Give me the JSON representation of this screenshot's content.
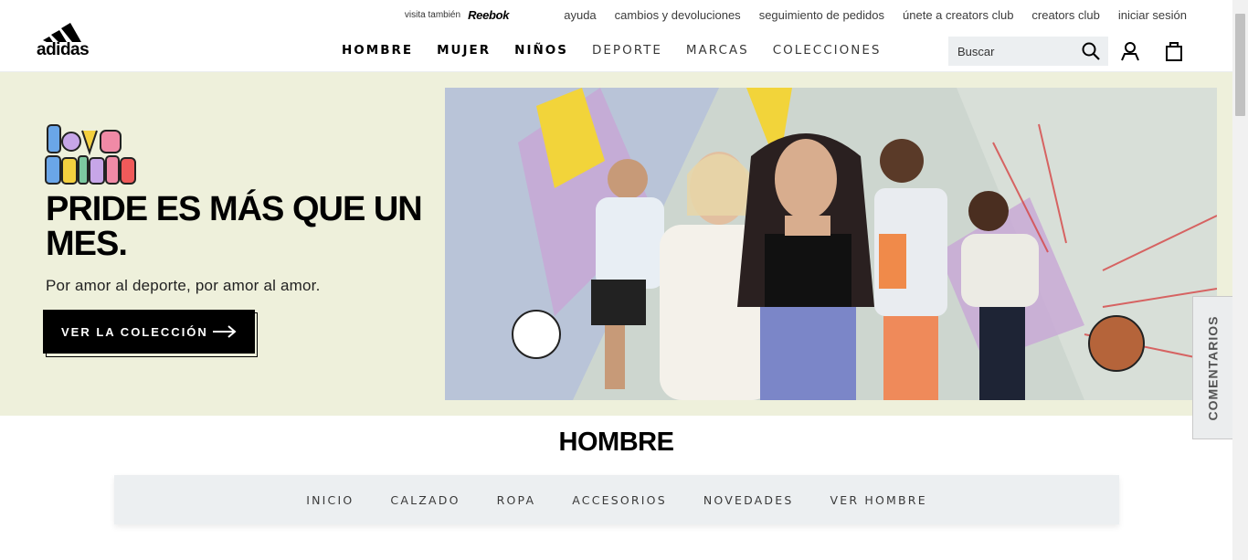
{
  "header": {
    "brand": "adidas",
    "util": {
      "also_visit": "visita también",
      "partner": "Reebok",
      "links": [
        "ayuda",
        "cambios y devoluciones",
        "seguimiento de pedidos",
        "únete a creators club",
        "creators club",
        "iniciar sesión"
      ]
    },
    "nav": [
      "HOMBRE",
      "MUJER",
      "NIÑOS",
      "DEPORTE",
      "MARCAS",
      "COLECCIONES"
    ],
    "search": {
      "placeholder": "Buscar"
    }
  },
  "hero": {
    "campaign_logo": "Love Unites",
    "title": "PRIDE ES MÁS QUE UN MES.",
    "subtitle": "Por amor al deporte, por amor al amor.",
    "cta": "VER LA COLECCIÓN"
  },
  "feedback": "COMENTARIOS",
  "section": {
    "title": "HOMBRE",
    "subnav": [
      "INICIO",
      "CALZADO",
      "ROPA",
      "ACCESORIOS",
      "NOVEDADES",
      "VER HOMBRE"
    ]
  },
  "colors": {
    "hero_bg": "#eef0db",
    "subnav_bg": "#eceff1",
    "cta_bg": "#000000"
  }
}
